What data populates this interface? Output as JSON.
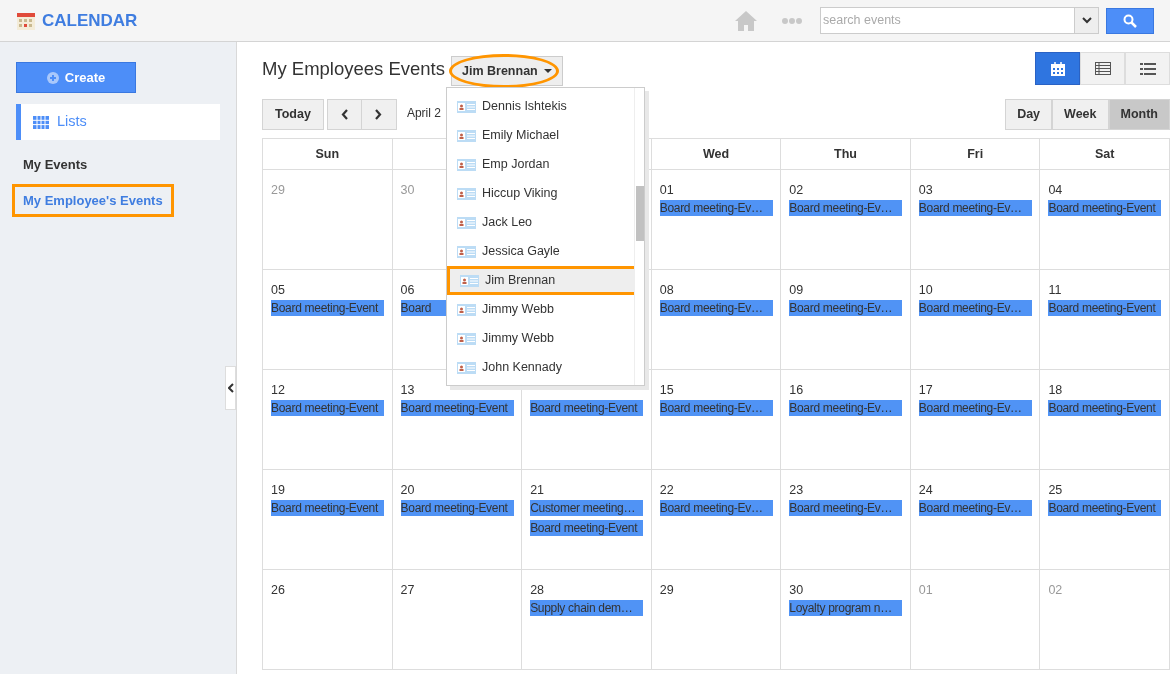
{
  "header": {
    "title": "CALENDAR",
    "search": {
      "placeholder": "search events"
    }
  },
  "sidebar": {
    "create": "Create",
    "lists": "Lists",
    "items": [
      {
        "label": "My Events",
        "selected": false
      },
      {
        "label": "My Employee's Events",
        "selected": true
      }
    ]
  },
  "main": {
    "title": "My Employees Events",
    "employee": "Jim Brennan",
    "view_modes": [
      {
        "kind": "calendar",
        "selected": true
      },
      {
        "kind": "table",
        "selected": false
      },
      {
        "kind": "list",
        "selected": false
      }
    ],
    "today": "Today",
    "month_label": "April 2",
    "ranges": [
      {
        "label": "Day",
        "selected": false
      },
      {
        "label": "Week",
        "selected": false
      },
      {
        "label": "Month",
        "selected": true
      }
    ]
  },
  "calendar": {
    "headers": {
      "sun": "Sun",
      "wed": "Wed",
      "thu": "Thu",
      "fri": "Fri",
      "sat": "Sat"
    },
    "weeks": [
      {
        "sun": {
          "day": "29",
          "other_month": true
        },
        "mon": {
          "day": "30",
          "other_month": true
        },
        "wed": {
          "day": "01",
          "other_month": false,
          "events": [
            "Board meeting-Ev…"
          ]
        },
        "thu": {
          "day": "02",
          "other_month": false,
          "events": [
            "Board meeting-Ev…"
          ]
        },
        "fri": {
          "day": "03",
          "other_month": false,
          "events": [
            "Board meeting-Ev…"
          ]
        },
        "sat": {
          "day": "04",
          "other_month": false,
          "events": [
            "Board meeting-Event"
          ]
        }
      },
      {
        "sun": {
          "day": "05",
          "other_month": false,
          "events": [
            "Board meeting-Event"
          ]
        },
        "mon": {
          "day": "06",
          "other_month": false,
          "events": [
            "Board"
          ]
        },
        "wed": {
          "day": "08",
          "other_month": false,
          "events": [
            "Board meeting-Ev…"
          ]
        },
        "thu": {
          "day": "09",
          "other_month": false,
          "events": [
            "Board meeting-Ev…"
          ]
        },
        "fri": {
          "day": "10",
          "other_month": false,
          "events": [
            "Board meeting-Ev…"
          ]
        },
        "sat": {
          "day": "11",
          "other_month": false,
          "events": [
            "Board meeting-Event"
          ]
        }
      },
      {
        "sun": {
          "day": "12",
          "other_month": false,
          "events": [
            "Board meeting-Event"
          ]
        },
        "mon": {
          "day": "13",
          "other_month": false,
          "events": [
            "Board meeting-Event"
          ]
        },
        "tue": {
          "events": [
            "Board meeting-Event"
          ]
        },
        "wed": {
          "day": "15",
          "other_month": false,
          "events": [
            "Board meeting-Ev…"
          ]
        },
        "thu": {
          "day": "16",
          "other_month": false,
          "events": [
            "Board meeting-Ev…"
          ]
        },
        "fri": {
          "day": "17",
          "other_month": false,
          "events": [
            "Board meeting-Ev…"
          ]
        },
        "sat": {
          "day": "18",
          "other_month": false,
          "events": [
            "Board meeting-Event"
          ]
        }
      },
      {
        "sun": {
          "day": "19",
          "other_month": false,
          "events": [
            "Board meeting-Event"
          ]
        },
        "mon": {
          "day": "20",
          "other_month": false,
          "events": [
            "Board meeting-Event"
          ]
        },
        "tue": {
          "day": "21",
          "other_month": false,
          "events": [
            "Customer meeting…",
            "Board meeting-Event"
          ]
        },
        "wed": {
          "day": "22",
          "other_month": false,
          "events": [
            "Board meeting-Ev…"
          ]
        },
        "thu": {
          "day": "23",
          "other_month": false,
          "events": [
            "Board meeting-Ev…"
          ]
        },
        "fri": {
          "day": "24",
          "other_month": false,
          "events": [
            "Board meeting-Ev…"
          ]
        },
        "sat": {
          "day": "25",
          "other_month": false,
          "events": [
            "Board meeting-Event"
          ]
        }
      },
      {
        "sun": {
          "day": "26",
          "other_month": false
        },
        "mon": {
          "day": "27",
          "other_month": false
        },
        "tue": {
          "day": "28",
          "other_month": false,
          "events": [
            "Supply chain dem…"
          ]
        },
        "wed": {
          "day": "29",
          "other_month": false
        },
        "thu": {
          "day": "30",
          "other_month": false,
          "events": [
            "Loyalty program n…"
          ]
        },
        "fri": {
          "day": "01",
          "other_month": true
        },
        "sat": {
          "day": "02",
          "other_month": true
        }
      }
    ]
  },
  "dropdown": {
    "items": [
      {
        "label": "Dennis Ishtekis",
        "selected": false
      },
      {
        "label": "Emily Michael",
        "selected": false
      },
      {
        "label": "Emp Jordan",
        "selected": false
      },
      {
        "label": "Hiccup Viking",
        "selected": false
      },
      {
        "label": "Jack Leo",
        "selected": false
      },
      {
        "label": "Jessica Gayle",
        "selected": false
      },
      {
        "label": "Jim Brennan",
        "selected": true
      },
      {
        "label": "Jimmy Webb",
        "selected": false
      },
      {
        "label": "Jimmy Webb",
        "selected": false
      },
      {
        "label": "John Kennady",
        "selected": false
      }
    ]
  }
}
